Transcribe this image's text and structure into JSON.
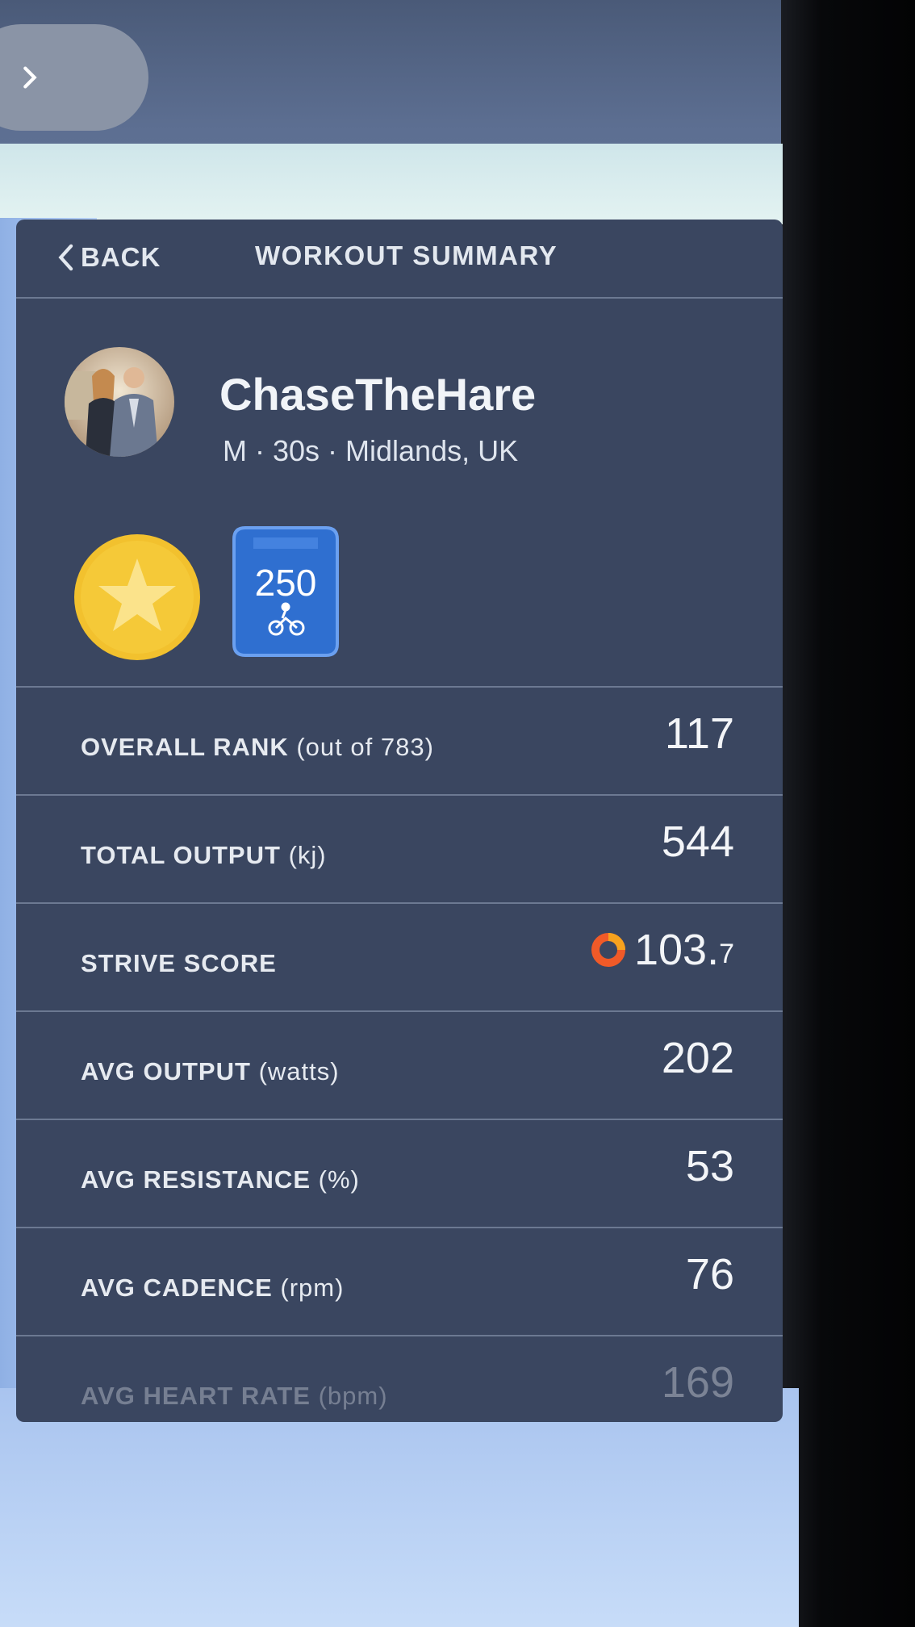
{
  "nav": {
    "expand_glyph": "›"
  },
  "header": {
    "back_label": "BACK",
    "title": "WORKOUT SUMMARY"
  },
  "profile": {
    "username": "ChaseTheHare",
    "meta": "M · 30s · Midlands, UK"
  },
  "badges": {
    "milestone_count": "250",
    "star_badge_icon": "star-icon",
    "milestone_icon": "cyclist-icon"
  },
  "stats": [
    {
      "label": "OVERALL RANK",
      "unit": "(out of 783)",
      "value": "117",
      "value_small": ""
    },
    {
      "label": "TOTAL OUTPUT",
      "unit": "(kj)",
      "value": "544",
      "value_small": ""
    },
    {
      "label": "STRIVE SCORE",
      "unit": "",
      "value": "103.",
      "value_small": "7"
    },
    {
      "label": "AVG OUTPUT",
      "unit": "(watts)",
      "value": "202",
      "value_small": ""
    },
    {
      "label": "AVG RESISTANCE",
      "unit": "(%)",
      "value": "53",
      "value_small": ""
    },
    {
      "label": "AVG CADENCE",
      "unit": "(rpm)",
      "value": "76",
      "value_small": ""
    },
    {
      "label": "AVG HEART RATE",
      "unit": "(bpm)",
      "value": "169",
      "value_small": ""
    }
  ],
  "colors": {
    "panel_bg": "#3a4660",
    "divider": "#6c7992",
    "star_badge": "#f2c12e",
    "milestone_badge": "#2f6fd0",
    "strive_ring_outer": "#f05a28",
    "strive_ring_inner": "#f6a21e"
  }
}
